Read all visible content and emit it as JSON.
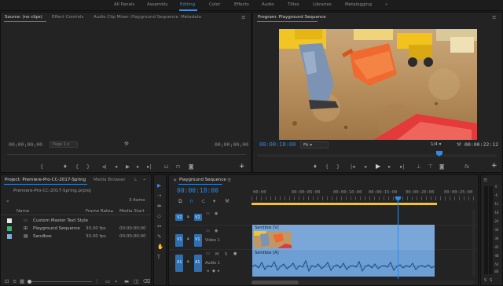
{
  "workspaces": [
    "All Panels",
    "Assembly",
    "Editing",
    "Color",
    "Effects",
    "Audio",
    "Titles",
    "Libraries",
    "Metalogging"
  ],
  "active_workspace": "Editing",
  "source_panel": {
    "tabs": [
      "Source: (no clips)",
      "Effect Controls",
      "Audio Clip Mixer: Playground Sequence",
      "Metadata"
    ],
    "timecode_left": "00;00;00;00",
    "page_label": "Page 1",
    "timecode_right": "00;00;00;00"
  },
  "program_panel": {
    "title": "Program: Playground Sequence",
    "timecode_current": "00:00:18:00",
    "fit": "Fit",
    "quality": "1/4",
    "timecode_duration": "00:00:22:12"
  },
  "project_panel": {
    "tabs": [
      "Project: Premiere-Pro-CC-2017-Spring",
      "Media Browser",
      "L"
    ],
    "file_name": "Premiere-Pro-CC-2017-Spring.prproj",
    "item_count": "3 Items",
    "columns": [
      "Name",
      "Frame Rate",
      "Media Start"
    ],
    "items": [
      {
        "name": "Custom Master Text Style",
        "frame_rate": "",
        "media_start": "",
        "color": "#e8e8e8"
      },
      {
        "name": "Playground Sequence",
        "frame_rate": "30.00 fps",
        "media_start": "00:00:00:00",
        "color": "#36b86e"
      },
      {
        "name": "Sandbox",
        "frame_rate": "30.00 fps",
        "media_start": "00:00:00:00",
        "color": "#7fb0e0"
      }
    ]
  },
  "timeline_panel": {
    "title": "Playground Sequence",
    "timecode": "00:00:18:00",
    "ruler": [
      "00:00",
      "00:00:05:00",
      "00:00:10:00",
      "00:00:15:00",
      "00:00:20:00",
      "00:00:25:00"
    ],
    "tracks": [
      {
        "id": "V2",
        "src": "V2",
        "label": ""
      },
      {
        "id": "V1",
        "src": "V1",
        "label": "Video 1"
      },
      {
        "id": "A1",
        "src": "A1",
        "label": "Audio 1"
      }
    ],
    "clip_video": "Sandbox [V]",
    "clip_audio": "Sandbox [A]"
  },
  "meter_scale": [
    "0",
    "-6",
    "-12",
    "-18",
    "-24",
    "-30",
    "-36",
    "-42",
    "-48",
    "-54",
    "dB"
  ],
  "colors": {
    "accent": "#2d8ceb",
    "clip_video": "#7aa7d8",
    "clip_audio": "#6d9ed4",
    "track_btn": "#2f6fb0"
  }
}
